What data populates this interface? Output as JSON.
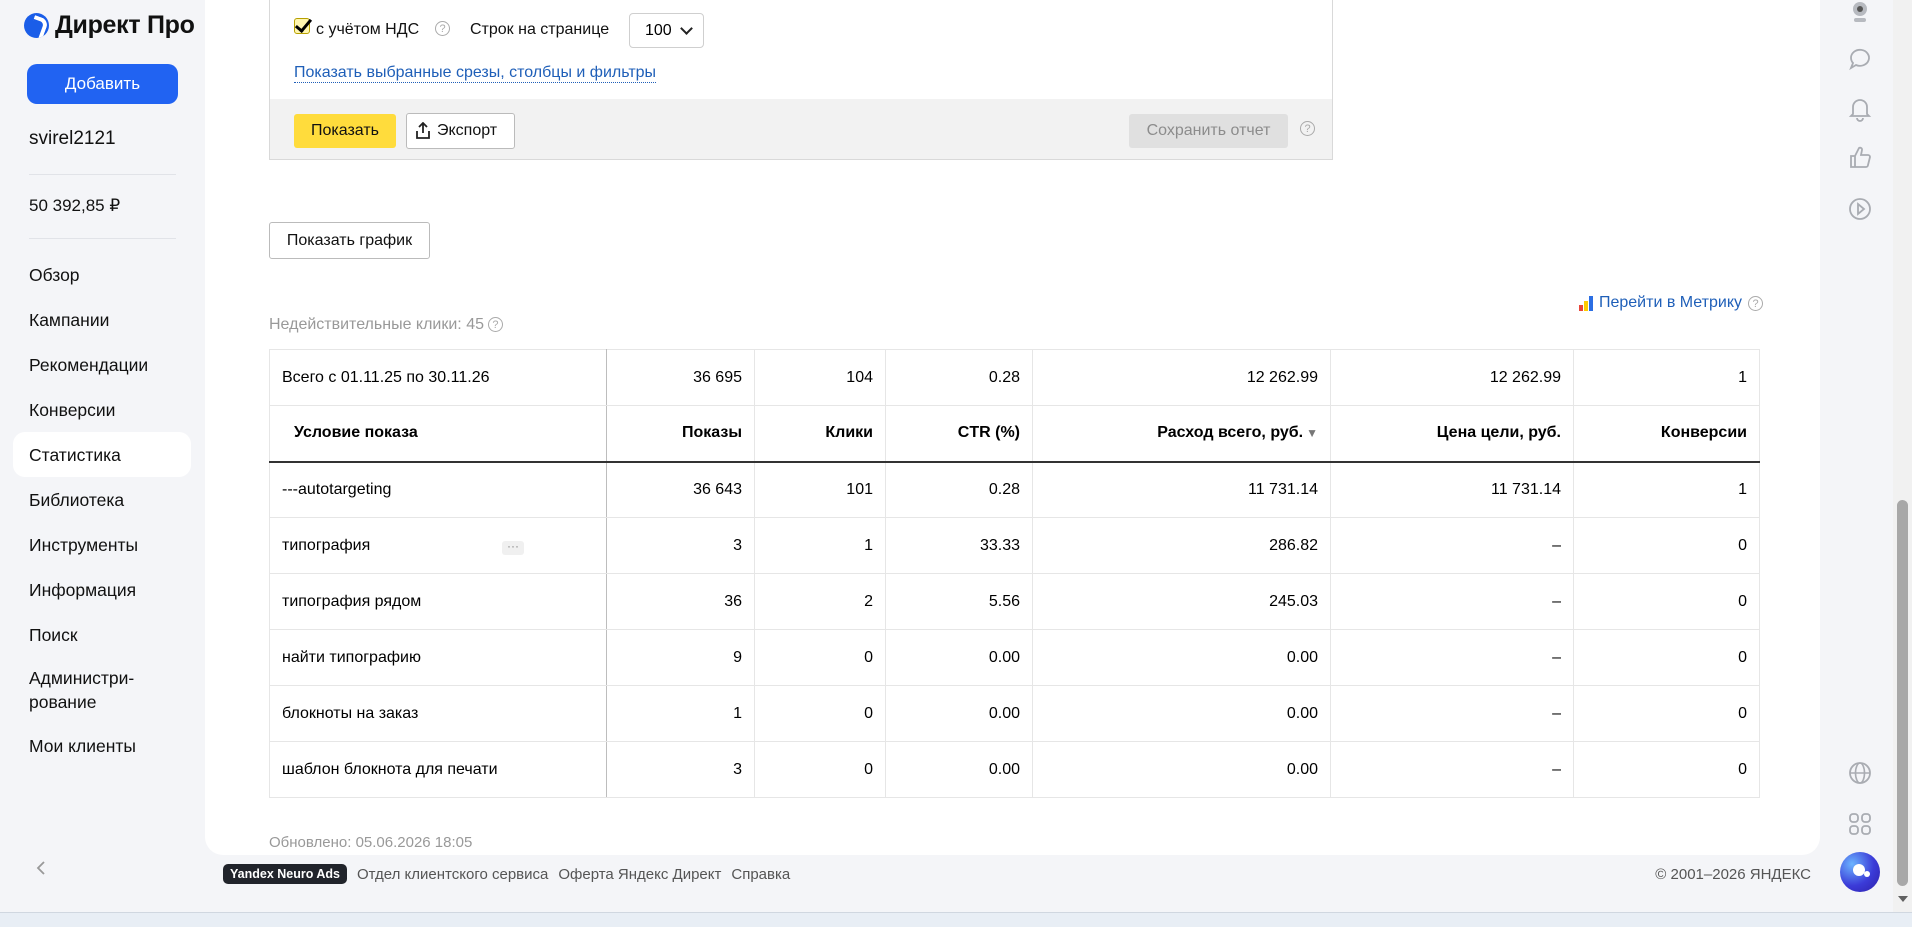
{
  "app": {
    "logo_text": "Директ Про"
  },
  "sidebar": {
    "add_label": "Добавить",
    "login": "svirel2121",
    "balance": "50 392,85 ₽",
    "items": [
      {
        "label": "Обзор"
      },
      {
        "label": "Кампании"
      },
      {
        "label": "Рекомендации"
      },
      {
        "label": "Конверсии"
      },
      {
        "label": "Статистика",
        "active": true
      },
      {
        "label": "Библиотека"
      },
      {
        "label": "Инструменты"
      },
      {
        "label": "Информация"
      },
      {
        "label": "Поиск"
      },
      {
        "label": "Администри-\nрование"
      },
      {
        "label": "Мои клиенты"
      }
    ]
  },
  "filters": {
    "vat_label": "с учётом НДС",
    "vat_checked": true,
    "rows_label": "Строк на странице",
    "rows_value": "100",
    "show_selected_link": "Показать выбранные срезы, столбцы и фильтры",
    "show_button": "Показать",
    "export_button": "Экспорт",
    "save_button": "Сохранить отчет"
  },
  "graph_button": "Показать график",
  "metrika_link": "Перейти в Метрику",
  "invalid_clicks": "Недействительные клики: 45",
  "table": {
    "totals": [
      "Всего с 01.11.25 по 30.11.26",
      "36 695",
      "104",
      "0.28",
      "12 262.99",
      "12 262.99",
      "1"
    ],
    "headers": [
      "Условие показа",
      "Показы",
      "Клики",
      "CTR (%)",
      "Расход всего, руб.",
      "Цена цели, руб.",
      "Конверсии"
    ],
    "sorted_column": "Расход всего, руб.",
    "rows": [
      [
        "---autotargeting",
        "36 643",
        "101",
        "0.28",
        "11 731.14",
        "11 731.14",
        "1"
      ],
      [
        "типография",
        "3",
        "1",
        "33.33",
        "286.82",
        "–",
        "0"
      ],
      [
        "типография рядом",
        "36",
        "2",
        "5.56",
        "245.03",
        "–",
        "0"
      ],
      [
        "найти типографию",
        "9",
        "0",
        "0.00",
        "0.00",
        "–",
        "0"
      ],
      [
        "блокноты на заказ",
        "1",
        "0",
        "0.00",
        "0.00",
        "–",
        "0"
      ],
      [
        "шаблон блокнота для печати",
        "3",
        "0",
        "0.00",
        "0.00",
        "–",
        "0"
      ]
    ]
  },
  "updated": "Обновлено: 05.06.2026 18:05",
  "footer": {
    "badge": "Yandex Neuro Ads",
    "links": [
      "Отдел клиентского сервиса",
      "Оферта Яндекс Директ",
      "Справка"
    ],
    "copyright": "© 2001–2026 ЯНДЕКС"
  },
  "icons": {
    "rail": [
      "webcam-icon",
      "chat-icon",
      "bell-icon",
      "thumbs-up-icon",
      "play-icon",
      "globe-icon",
      "apps-grid-icon"
    ],
    "alice": "alice-assistant-icon"
  },
  "colors": {
    "accent": "#2163f2",
    "yellow_button": "#ffdc3c",
    "link": "#1f5fb8"
  }
}
